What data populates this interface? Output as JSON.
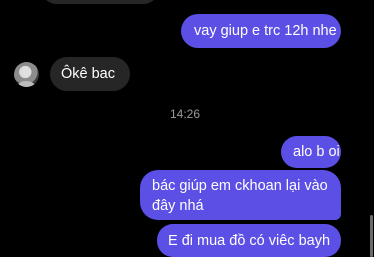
{
  "messages": [
    {
      "text": "vay giup e trc 12h nhe"
    },
    {
      "text": "Ôkê bac"
    },
    {
      "text": "alo b oi"
    },
    {
      "text": "bác giúp em ckhoan lại vào đây nhá"
    },
    {
      "text": "E đi mua đồ có viêc bayh"
    }
  ],
  "timestamp": "14:26",
  "colors": {
    "background": "#000000",
    "outgoing_bubble": "#5b4fe6",
    "incoming_bubble": "#262626",
    "timestamp_text": "#9a9a9a"
  }
}
